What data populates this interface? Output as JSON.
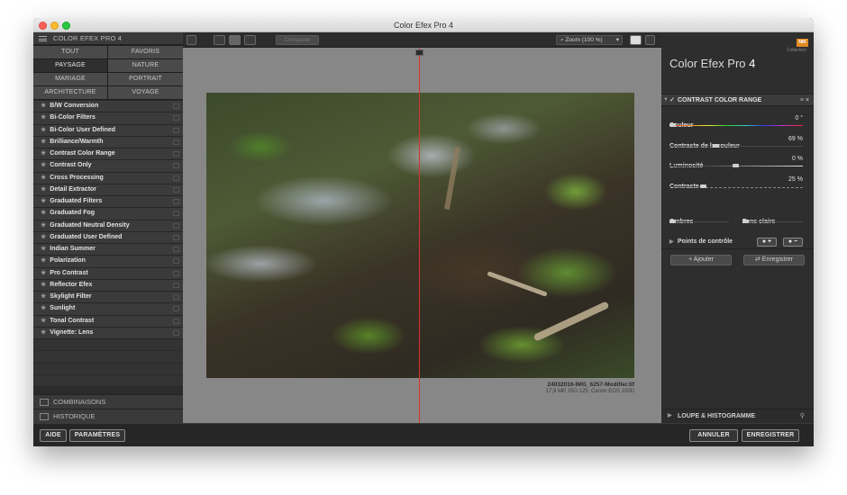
{
  "window": {
    "title": "Color Efex Pro 4"
  },
  "left_panel": {
    "header": "COLOR EFEX PRO 4",
    "categories": [
      {
        "label": "TOUT",
        "active": false
      },
      {
        "label": "FAVORIS",
        "active": false
      },
      {
        "label": "PAYSAGE",
        "active": true
      },
      {
        "label": "NATURE",
        "active": false
      },
      {
        "label": "MARIAGE",
        "active": false
      },
      {
        "label": "PORTRAIT",
        "active": false
      },
      {
        "label": "ARCHITECTURE",
        "active": false
      },
      {
        "label": "VOYAGE",
        "active": false
      }
    ],
    "filters": [
      "B/W Conversion",
      "Bi-Color Filters",
      "Bi-Color User Defined",
      "Brilliance/Warmth",
      "Contrast Color Range",
      "Contrast Only",
      "Cross Processing",
      "Detail Extractor",
      "Graduated Filters",
      "Graduated Fog",
      "Graduated Neutral Density",
      "Graduated User Defined",
      "Indian Summer",
      "Polarization",
      "Pro Contrast",
      "Reflector Efex",
      "Skylight Filter",
      "Sunlight",
      "Tonal Contrast",
      "Vignette: Lens"
    ],
    "combinations_label": "COMBINAISONS",
    "history_label": "HISTORIQUE"
  },
  "toolbar": {
    "compare_label": "Comparer",
    "zoom_label": "Zoom (100 %)"
  },
  "preview": {
    "file_name": "24032016-IMG_6257-Modifier.tif",
    "file_info": "17,9 MP, ISO 125, Canon EOS 100D"
  },
  "right_panel": {
    "brand": "Collection",
    "brand_badge": "NIK",
    "app_title": "Color Efex Pro",
    "app_version": "4",
    "filter_title": "CONTRAST COLOR RANGE",
    "controls": [
      {
        "label": "Couleur",
        "value": "0 °",
        "level": 0.0
      },
      {
        "label": "Contraste de la couleur",
        "value": "69 %",
        "level": 0.35
      },
      {
        "label": "Luminosité",
        "value": "0 %",
        "level": 0.5
      },
      {
        "label": "Contraste",
        "value": "25 %",
        "level": 0.25
      }
    ],
    "shadows_label": "Ombres",
    "highlights_label": "Tons clairs",
    "control_points_label": "Points de contrôle",
    "add_label": "Ajouter",
    "save_label": "Enregistrer",
    "loupe_label": "LOUPE & HISTOGRAMME"
  },
  "bottom": {
    "help": "AIDE",
    "settings": "PARAMÈTRES",
    "cancel": "ANNULER",
    "save": "ENREGISTRER"
  }
}
